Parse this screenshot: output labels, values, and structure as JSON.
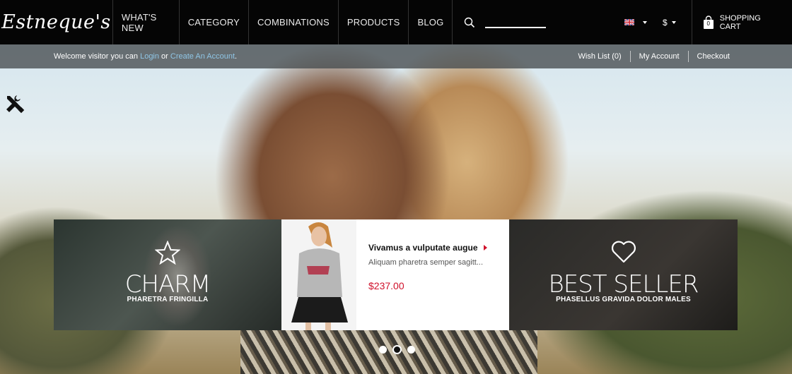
{
  "header": {
    "logo_text": "Estneque's",
    "nav": [
      {
        "label": "WHAT'S NEW"
      },
      {
        "label": "CATEGORY"
      },
      {
        "label": "COMBINATIONS"
      },
      {
        "label": "PRODUCTS"
      },
      {
        "label": "BLOG"
      }
    ],
    "search": {
      "value": "",
      "placeholder": ""
    },
    "language_icon": "uk-flag-icon",
    "currency_label": "$",
    "cart": {
      "count": "0",
      "label": "SHOPPING CART"
    }
  },
  "welcome_bar": {
    "prefix": "Welcome visitor you can ",
    "login": "Login",
    "or": " or ",
    "create": "Create An Account",
    "suffix": ".",
    "links": [
      "Wish List (0)",
      "My Account",
      "Checkout"
    ]
  },
  "banners": {
    "charm": {
      "icon": "star-icon",
      "title": "CHARM",
      "subtitle": "PHARETRA FRINGILLA"
    },
    "product": {
      "name": "Vivamus a vulputate augue",
      "description": "Aliquam pharetra semper sagitt...",
      "price": "$237.00"
    },
    "best_seller": {
      "icon": "heart-icon",
      "title": "BEST SELLER",
      "subtitle": "PHASELLUS GRAVIDA DOLOR MALES"
    }
  },
  "slider": {
    "dot_count": 3,
    "active_index": 1
  },
  "colors": {
    "accent_red": "#d0112b",
    "link_blue": "#8fc6e6",
    "topbar": "#050505"
  }
}
